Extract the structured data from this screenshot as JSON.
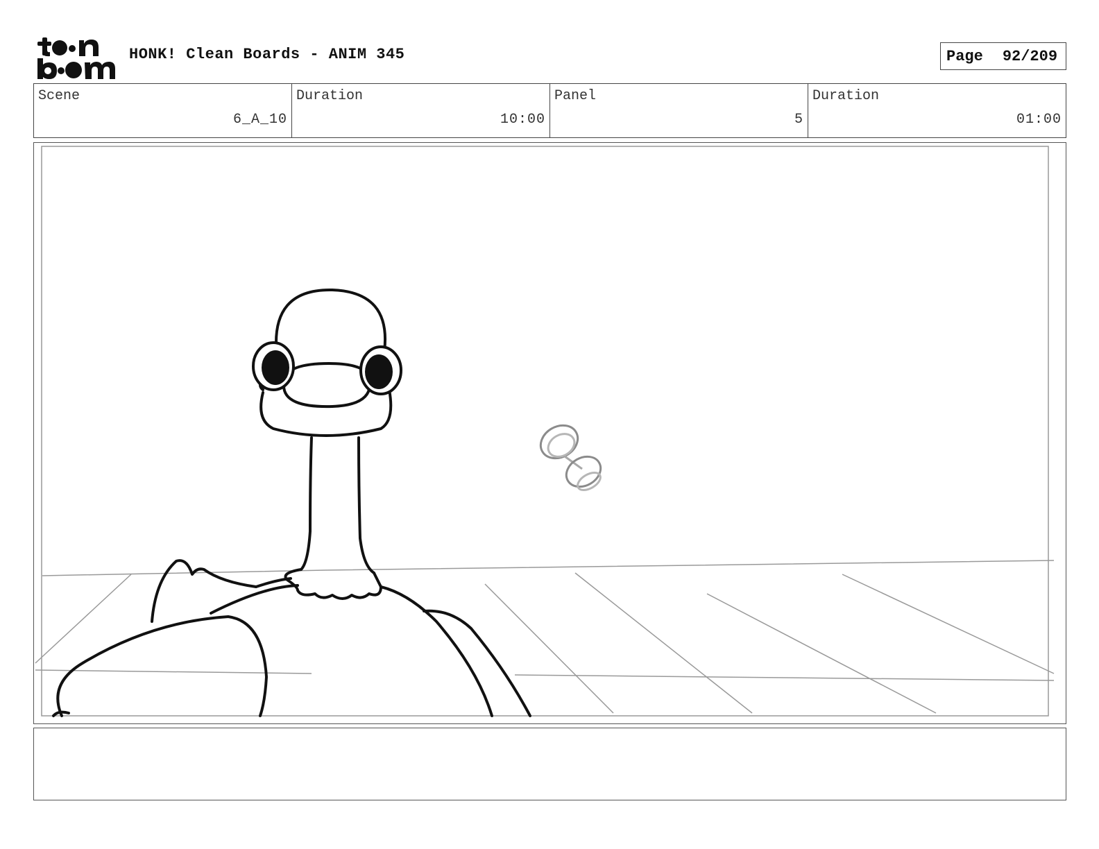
{
  "header": {
    "logo_text": "toon boom",
    "title": "HONK! Clean Boards - ANIM 345",
    "page_label": "Page",
    "page_value": "92/209"
  },
  "info": [
    {
      "label": "Scene",
      "value": "6_A_10"
    },
    {
      "label": "Duration",
      "value": "10:00"
    },
    {
      "label": "Panel",
      "value": "5"
    },
    {
      "label": "Duration",
      "value": "01:00"
    }
  ],
  "notes": {
    "text": ""
  }
}
